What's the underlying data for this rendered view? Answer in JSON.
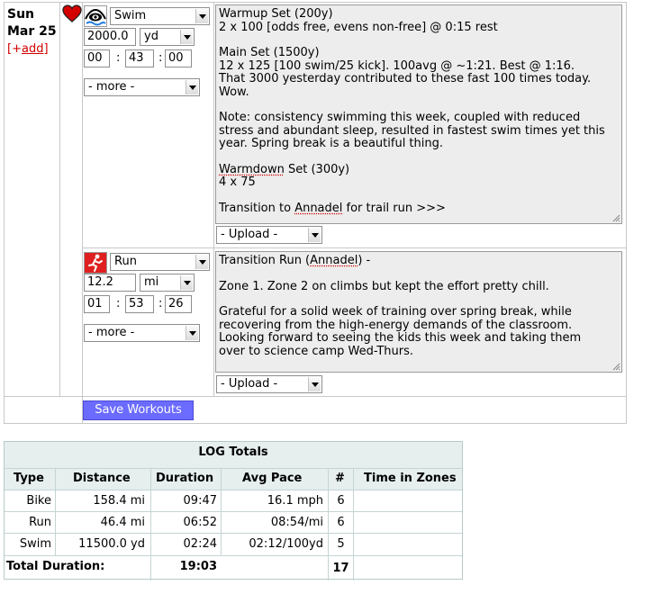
{
  "day": {
    "weekday": "Sun",
    "date": "Mar 25",
    "add_plus": "+",
    "add_label": "add"
  },
  "workouts": [
    {
      "sport": "Swim",
      "distance": "2000.0",
      "unit": "yd",
      "hours": "00",
      "minutes": "43",
      "seconds": "00",
      "more": "- more -",
      "upload": "- Upload -",
      "notes": {
        "l1": "Warmup Set (200y)",
        "l2": "2 x 100 [odds free, evens non-free] @ 0:15 rest",
        "l3": "Main Set (1500y)",
        "l4": "12 x 125 [100 swim/25 kick]. 100avg @ ~1:21. Best @ 1:16.",
        "l5": "That 3000 yesterday contributed to these fast 100 times today.",
        "l6": "Wow.",
        "l7": "Note: consistency swimming this week, coupled with reduced",
        "l8": "stress and abundant sleep, resulted in fastest swim times yet this",
        "l9": "year. Spring break is a beautiful thing.",
        "l10a": "Warmdown",
        "l10b": " Set (300y)",
        "l11": "4 x 75",
        "l12a": "Transition to ",
        "l12b": "Annadel",
        "l12c": " for trail run >>>"
      }
    },
    {
      "sport": "Run",
      "distance": "12.2",
      "unit": "mi",
      "hours": "01",
      "minutes": "53",
      "seconds": "26",
      "more": "- more -",
      "upload": "- Upload -",
      "notes": {
        "l1a": "Transition Run (",
        "l1b": "Annadel",
        "l1c": ") -",
        "l2": "Zone 1. Zone 2 on climbs but kept the effort pretty chill.",
        "l3": "Grateful for a solid week of training over spring break, while",
        "l4": "recovering from the high-energy demands of the classroom.",
        "l5": "Looking forward to seeing the kids this week and taking them",
        "l6": "over to science camp Wed-Thurs."
      }
    }
  ],
  "save_label": "Save Workouts",
  "totals": {
    "title": "LOG Totals",
    "headers": [
      "Type",
      "Distance",
      "Duration",
      "Avg Pace",
      "#",
      "Time in Zones"
    ],
    "rows": [
      [
        "Bike",
        "158.4 mi",
        "09:47",
        "16.1 mph",
        "6",
        ""
      ],
      [
        "Run",
        "46.4 mi",
        "06:52",
        "08:54/mi",
        "6",
        ""
      ],
      [
        "Swim",
        "11500.0 yd",
        "02:24",
        "02:12/100yd",
        "5",
        ""
      ]
    ],
    "footer": {
      "label": "Total Duration:",
      "duration": "19:03",
      "count": "17"
    }
  },
  "colors": {
    "save_button": "#6b6bff",
    "add_link": "#d00000",
    "heart": "#d40000",
    "table_header": "#e6eeee"
  }
}
